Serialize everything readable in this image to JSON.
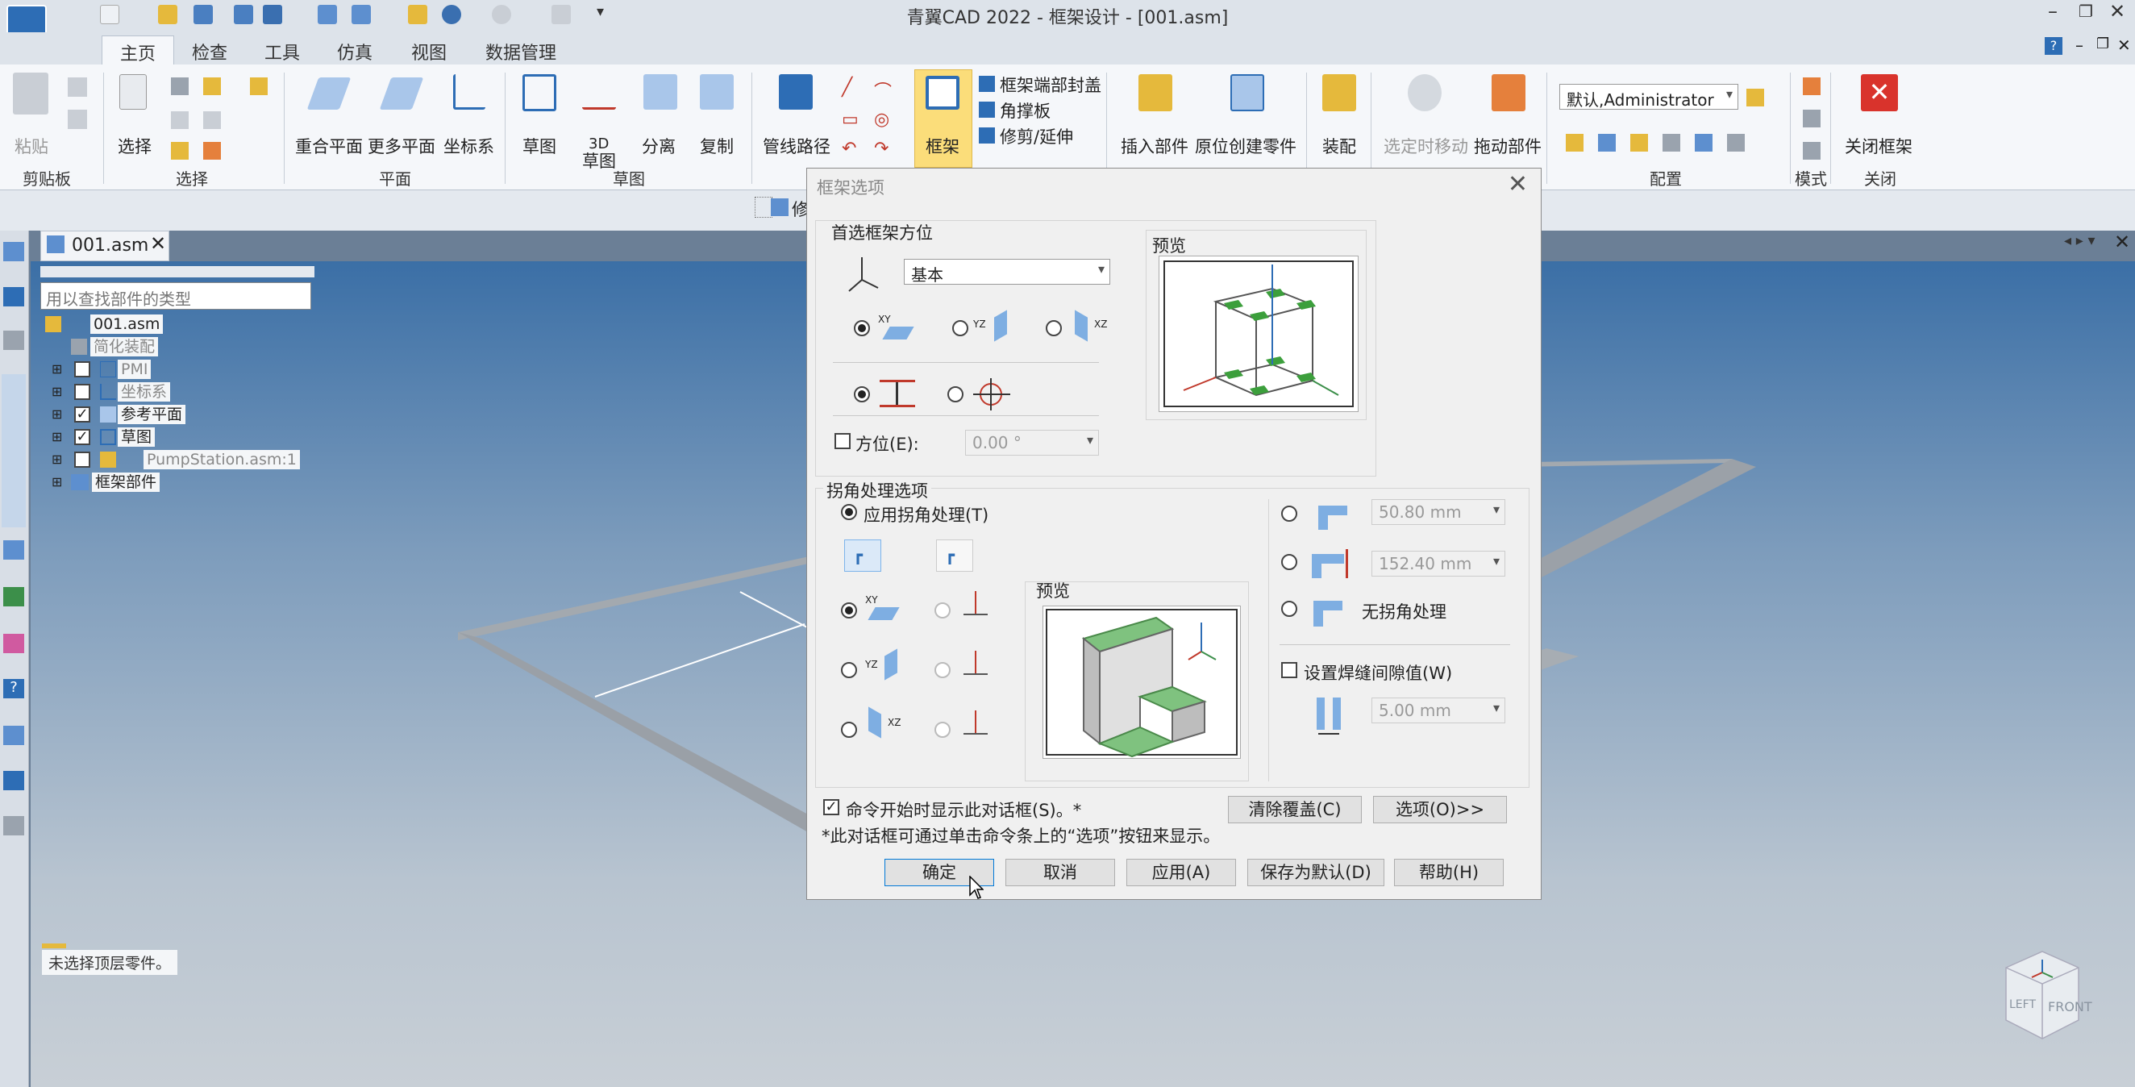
{
  "window": {
    "title": "青翼CAD 2022 - 框架设计 - [001.asm]"
  },
  "tabs": [
    "主页",
    "检查",
    "工具",
    "仿真",
    "视图",
    "数据管理"
  ],
  "ribbon": {
    "clipboard": {
      "paste": "粘贴",
      "group": "剪贴板"
    },
    "select": {
      "select": "选择",
      "group": "选择"
    },
    "plane": {
      "coincident": "重合平面",
      "more": "更多平面",
      "coord": "坐标系",
      "group": "平面"
    },
    "sketch": {
      "sketch": "草图",
      "sketch3d_top": "3D",
      "sketch3d_bottom": "草图",
      "split": "分离",
      "copy": "复制",
      "group": "草图"
    },
    "pipe": {
      "pipe_path": "管线路径"
    },
    "frame": {
      "frame": "框架",
      "end_cap": "框架端部封盖",
      "gusset": "角撑板",
      "trim": "修剪/延伸"
    },
    "insert": {
      "insert_part": "插入部件",
      "in_place": "原位创建零件"
    },
    "assembly": {
      "assembly": "装配"
    },
    "move": {
      "select_move": "选定时移动",
      "drag_part": "拖动部件"
    },
    "config": {
      "user": "默认,Administrator",
      "group": "配置"
    },
    "mode": {
      "group": "模式"
    },
    "close": {
      "close_frame": "关闭框架",
      "group": "关闭"
    }
  },
  "doc_tab": {
    "name": "001.asm"
  },
  "cmdbar": {
    "partial": "修"
  },
  "tree": {
    "search_placeholder": "用以查找部件的类型",
    "items": [
      {
        "label": "001.asm"
      },
      {
        "label": "简化装配"
      },
      {
        "label": "PMI"
      },
      {
        "label": "坐标系"
      },
      {
        "label": "参考平面"
      },
      {
        "label": "草图"
      },
      {
        "label": "PumpStation.asm:1"
      },
      {
        "label": "框架部件"
      }
    ]
  },
  "status": {
    "message": "未选择顶层零件。"
  },
  "viewcube": {
    "face_front": "FRONT",
    "face_left": "LEFT"
  },
  "dialog": {
    "title": "框架选项",
    "orientation": {
      "group": "首选框架方位",
      "combo_value": "基本",
      "planes": [
        "XY",
        "YZ",
        "XZ"
      ],
      "angle_label": "方位(E):",
      "angle_value": "0.00 °"
    },
    "preview_label": "预览",
    "corner": {
      "group": "拐角处理选项",
      "apply_label": "应用拐角处理(T)",
      "preview_label": "预览",
      "planes": [
        "XY",
        "YZ",
        "XZ"
      ],
      "miter_value": "50.80 mm",
      "butt_value": "152.40 mm",
      "none_label": "无拐角处理",
      "gap_label": "设置焊缝间隙值(W)",
      "gap_value": "5.00 mm"
    },
    "show_on_start": "命令开始时显示此对话框(S)。*",
    "note": "*此对话框可通过单击命令条上的“选项”按钮来显示。",
    "buttons": {
      "clear": "清除覆盖(C)",
      "options": "选项(O)>>",
      "ok": "确定",
      "cancel": "取消",
      "apply": "应用(A)",
      "save_default": "保存为默认(D)",
      "help": "帮助(H)"
    }
  }
}
